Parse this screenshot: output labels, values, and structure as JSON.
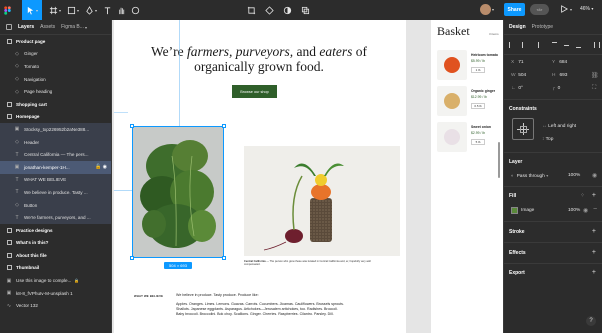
{
  "toolbar": {
    "share_label": "Share",
    "zoom_label": "46%",
    "avatar_initials": "CG"
  },
  "left_panel": {
    "tabs": [
      "Layers",
      "Assets",
      "Figma B..."
    ],
    "layers": [
      {
        "label": "Product page",
        "kind": "page",
        "icon": "frame-icon"
      },
      {
        "label": "Ginger",
        "kind": "child",
        "icon": "component-icon"
      },
      {
        "label": "Tomato",
        "kind": "child",
        "icon": "component-icon"
      },
      {
        "label": "Navigation",
        "kind": "child",
        "icon": "component-icon"
      },
      {
        "label": "Page heading",
        "kind": "child",
        "icon": "component-icon"
      },
      {
        "label": "Shopping cart",
        "kind": "page",
        "icon": "frame-icon"
      },
      {
        "label": "Homepage",
        "kind": "page",
        "icon": "frame-icon"
      },
      {
        "label": "Stocksy_txp226952b2aNe388...",
        "kind": "child",
        "icon": "image-icon"
      },
      {
        "label": "Header",
        "kind": "child",
        "icon": "component-icon"
      },
      {
        "label": "Central California — The pers...",
        "kind": "child",
        "icon": "text-icon"
      },
      {
        "label": "jonathan-kemper-1H...",
        "kind": "selected",
        "icon": "image-icon"
      },
      {
        "label": "WHAT WE BELIEVE",
        "kind": "child",
        "icon": "text-icon"
      },
      {
        "label": "We believe in produce. Tasty ...",
        "kind": "child",
        "icon": "text-icon"
      },
      {
        "label": "Button",
        "kind": "child",
        "icon": "component-icon"
      },
      {
        "label": "We're farmers, purveyors, and ...",
        "kind": "child",
        "icon": "text-icon"
      },
      {
        "label": "Practice designs",
        "kind": "page",
        "icon": "frame-icon"
      },
      {
        "label": "What's in this?",
        "kind": "page",
        "icon": "frame-icon"
      },
      {
        "label": "About this file",
        "kind": "page",
        "icon": "frame-icon"
      },
      {
        "label": "Thumbnail",
        "kind": "page",
        "icon": "frame-icon"
      },
      {
        "label": "Use this image to comple...",
        "kind": "plain",
        "icon": "image-icon"
      },
      {
        "label": "k8-8_fVPhuIv-M-unsplash 1",
        "kind": "plain",
        "icon": "image-icon"
      },
      {
        "label": "Vector 132",
        "kind": "plain",
        "icon": "vector-icon"
      }
    ]
  },
  "right_panel": {
    "tabs": [
      "Design",
      "Prototype"
    ],
    "x": "71",
    "y": "684",
    "w": "504",
    "h": "693",
    "rotation": "0°",
    "radius": "0",
    "labels": {
      "x": "X",
      "y": "Y",
      "w": "W",
      "h": "H"
    },
    "constraints_title": "Constraints",
    "constraint_h": "Left and right",
    "constraint_v": "Top",
    "layer_title": "Layer",
    "blend_mode": "Pass through",
    "layer_opacity": "100%",
    "fill_title": "Fill",
    "fill_type": "Image",
    "fill_opacity": "100%",
    "stroke_title": "Stroke",
    "effects_title": "Effects",
    "export_title": "Export"
  },
  "canvas": {
    "hero_line1_a": "We’re ",
    "hero_line1_b": "farmers, purveyors,",
    "hero_line1_c": " and ",
    "hero_line1_d": "eaters",
    "hero_line1_e": " of",
    "hero_line2": "organically grown food.",
    "cta_label": "Browse our shop",
    "size_badge": "504 × 693",
    "caption_title": "Central California",
    "caption_text": "— The person who grew these was located in Central California and, er, hopefully very well compensated.",
    "believe_heading": "WHAT WE BELIEVE",
    "believe_intro": "We believe in produce. Tasty produce. Produce like:",
    "believe_list": "Apples. Oranges. Limes. Lemons. Guavas. Carrots. Cucumbers. Jicamas. Cauliflowers. Brussels sprouts. Shallots. Japanese eggplants. Asparagus. Artichokes—Jerusalem artichokes, too. Radishes. Broccoli. Baby broccoli. Broccolini. Bok choy. Scallions. Ginger. Cherries. Raspberries. Cilantro. Parsley. Dill.",
    "basket_title": "Basket",
    "basket_count": "3 items",
    "cart_items": [
      {
        "name": "Heirloom tomato",
        "price": "$5.99 / lb",
        "qty": "1 lb"
      },
      {
        "name": "Organic ginger",
        "price": "$12.99 / lb",
        "qty": "0.5 lb"
      },
      {
        "name": "Sweet onion",
        "price": "$2.99 / lb",
        "qty": "5 lb"
      }
    ]
  },
  "colors": {
    "accent": "#0d99ff",
    "panel": "#2c2c2c",
    "button_green": "#2f5f2a",
    "selection": "#4c5a75"
  }
}
